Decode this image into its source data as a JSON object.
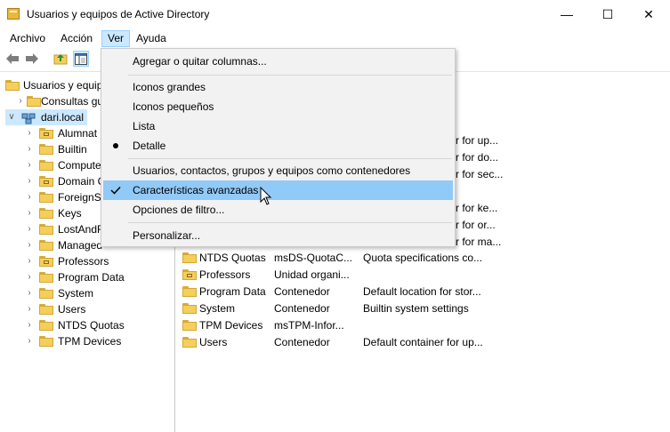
{
  "window": {
    "title": "Usuarios y equipos de Active Directory",
    "minimize": "—",
    "maximize": "☐",
    "close": "✕"
  },
  "menubar": {
    "items": [
      "Archivo",
      "Acción",
      "Ver",
      "Ayuda"
    ],
    "active": "Ver"
  },
  "toolbar": {
    "icons": [
      "back-icon",
      "forward-icon",
      "up-folder-icon",
      "show-hide-console-tree-icon"
    ]
  },
  "tree": {
    "root": "Usuarios y equipos",
    "saved_queries": "Consultas gu",
    "domain": "dari.local",
    "children": [
      {
        "label": "Alumnat",
        "type": "ou"
      },
      {
        "label": "Builtin",
        "type": "folder"
      },
      {
        "label": "Compute",
        "type": "folder"
      },
      {
        "label": "Domain C",
        "type": "ou"
      },
      {
        "label": "ForeignSe",
        "type": "folder"
      },
      {
        "label": "Keys",
        "type": "folder"
      },
      {
        "label": "LostAndF",
        "type": "folder"
      },
      {
        "label": "Managed",
        "type": "folder"
      },
      {
        "label": "Professors",
        "type": "ou"
      },
      {
        "label": "Program Data",
        "type": "folder"
      },
      {
        "label": "System",
        "type": "folder"
      },
      {
        "label": "Users",
        "type": "folder"
      },
      {
        "label": "NTDS Quotas",
        "type": "folder"
      },
      {
        "label": "TPM Devices",
        "type": "folder"
      }
    ]
  },
  "list": {
    "partial_rows": [
      {
        "desc": "r for up..."
      },
      {
        "desc": "r for do..."
      },
      {
        "desc": "r for sec..."
      },
      {
        "desc": "r for ke..."
      },
      {
        "desc": "r for or..."
      },
      {
        "desc": "r for ma..."
      }
    ],
    "rows": [
      {
        "name": "NTDS Quotas",
        "type": "msDS-QuotaC...",
        "desc": "Quota specifications co...",
        "icon": "folder"
      },
      {
        "name": "Professors",
        "type": "Unidad organi...",
        "desc": "",
        "icon": "ou"
      },
      {
        "name": "Program Data",
        "type": "Contenedor",
        "desc": "Default location for stor...",
        "icon": "folder"
      },
      {
        "name": "System",
        "type": "Contenedor",
        "desc": "Builtin system settings",
        "icon": "folder"
      },
      {
        "name": "TPM Devices",
        "type": "msTPM-Infor...",
        "desc": "",
        "icon": "folder"
      },
      {
        "name": "Users",
        "type": "Contenedor",
        "desc": "Default container for up...",
        "icon": "folder"
      }
    ]
  },
  "ver_menu": {
    "items": [
      {
        "label": "Agregar o quitar columnas...",
        "mark": ""
      },
      {
        "label": "Iconos grandes",
        "mark": ""
      },
      {
        "label": "Iconos pequeños",
        "mark": ""
      },
      {
        "label": "Lista",
        "mark": ""
      },
      {
        "label": "Detalle",
        "mark": "radio"
      },
      {
        "label": "Usuarios, contactos, grupos y equipos como contenedores",
        "mark": ""
      },
      {
        "label": "Características avanzadas",
        "mark": "check",
        "highlighted": true
      },
      {
        "label": "Opciones de filtro...",
        "mark": ""
      },
      {
        "label": "Personalizar...",
        "mark": ""
      }
    ]
  },
  "colors": {
    "menu_highlight": "#91c9f7",
    "active_menu": "#cce8ff",
    "folder": "#f5cf5b"
  }
}
